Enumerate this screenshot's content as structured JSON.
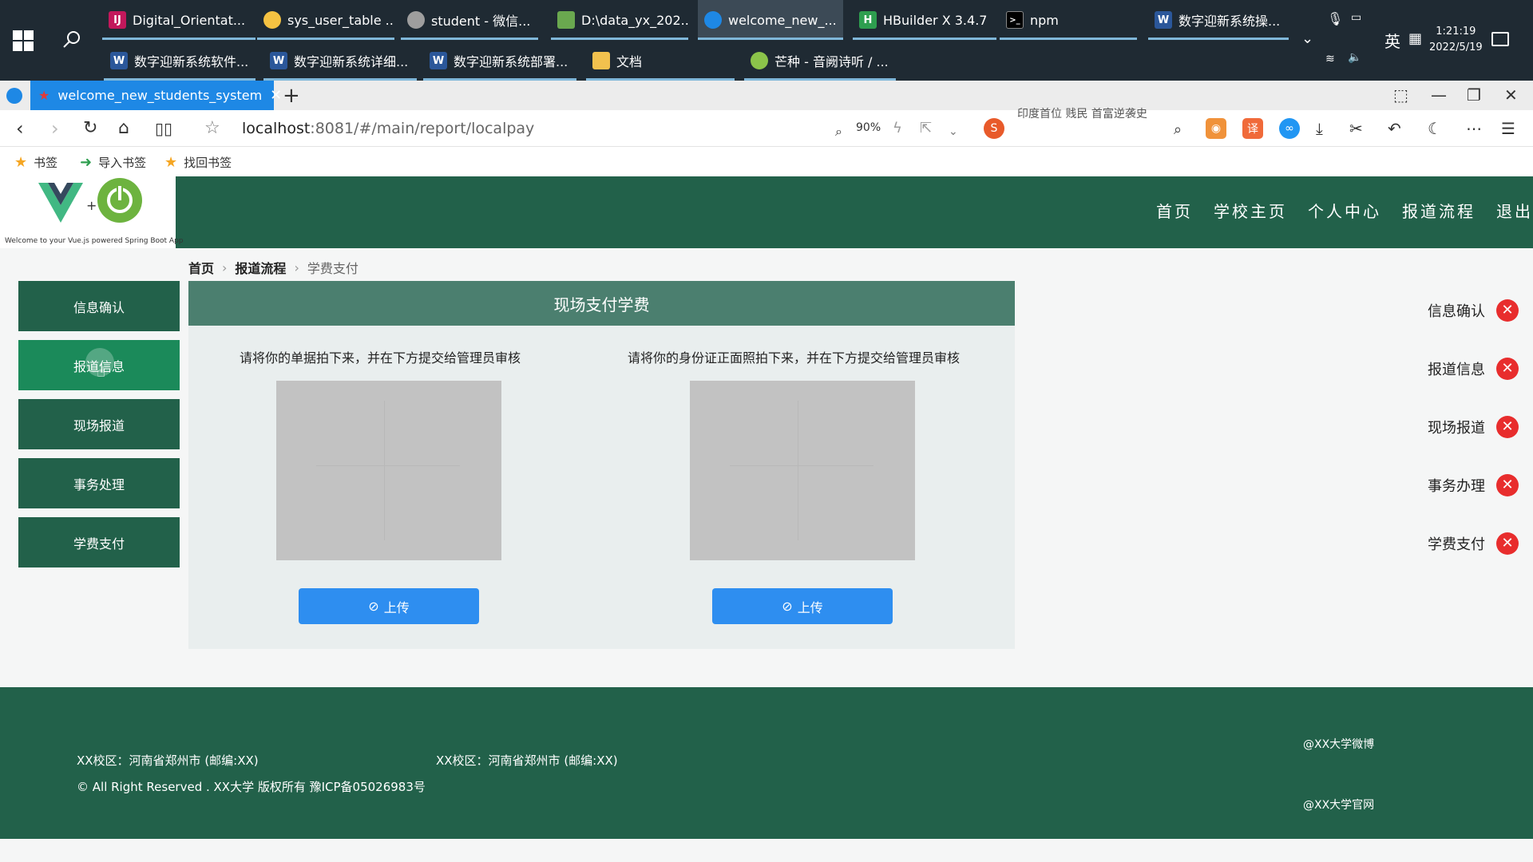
{
  "taskbar": {
    "row1": [
      {
        "label": "Digital_Orientat...",
        "icon": "intellij-icon",
        "color": "#c2185b"
      },
      {
        "label": "sys_user_table ...",
        "icon": "navicat-icon",
        "color": "#f5c242"
      },
      {
        "label": "student - 微信...",
        "icon": "wechat-icon",
        "color": "#9e9e9e"
      },
      {
        "label": "D:\\data_yx_202...",
        "icon": "image-viewer-icon",
        "color": "#6aa84f"
      },
      {
        "label": "welcome_new_...",
        "icon": "browser-icon",
        "color": "#1e88e5"
      },
      {
        "label": "HBuilder X 3.4.7",
        "icon": "hbuilder-icon",
        "color": "#2e9e4f"
      },
      {
        "label": "npm",
        "icon": "terminal-icon",
        "color": "#000000"
      },
      {
        "label": "数字迎新系统操...",
        "icon": "word-icon",
        "color": "#2b579a"
      }
    ],
    "row2": [
      {
        "label": "数字迎新系统软件...",
        "icon": "word-icon",
        "color": "#2b579a"
      },
      {
        "label": "数字迎新系统详细...",
        "icon": "word-icon",
        "color": "#2b579a"
      },
      {
        "label": "数字迎新系统部署...",
        "icon": "word-icon",
        "color": "#2b579a"
      },
      {
        "label": "文档",
        "icon": "folder-icon",
        "color": "#f2c14e"
      },
      {
        "label": "芒种 - 音阙诗听 / ...",
        "icon": "music-player-icon",
        "color": "#8bc34a"
      }
    ],
    "ime": "英",
    "time": "1:21:19",
    "date": "2022/5/19"
  },
  "browser": {
    "tab_title": "welcome_new_students_system",
    "url_host": "localhost",
    "url_rest": ":8081/#/main/report/localpay",
    "zoom": "90%",
    "hint_text": "印度首位 贱民 首富逆袭史",
    "bookmarks": [
      "书签",
      "导入书签",
      "找回书签"
    ]
  },
  "site": {
    "logo_caption": "Welcome to your Vue.js powered Spring Boot App",
    "nav": [
      "首页",
      "学校主页",
      "个人中心",
      "报道流程",
      "退出"
    ],
    "breadcrumb": [
      "首页",
      "报道流程",
      "学费支付"
    ],
    "side_menu": [
      "信息确认",
      "报道信息",
      "现场报道",
      "事务处理",
      "学费支付"
    ],
    "card_title": "现场支付学费",
    "upload_left_hint": "请将你的单据拍下来，并在下方提交给管理员审核",
    "upload_right_hint": "请将你的身份证正面照拍下来，并在下方提交给管理员审核",
    "upload_button": "上传",
    "steps": [
      "信息确认",
      "报道信息",
      "现场报道",
      "事务办理",
      "学费支付"
    ],
    "footer": {
      "campus1": "XX校区：河南省郑州市 (邮编:XX)",
      "campus2": "XX校区：河南省郑州市 (邮编:XX)",
      "copyright": "© All Right Reserved . XX大学 版权所有 豫ICP备05026983号",
      "weibo": "@XX大学微博",
      "official": "@XX大学官网"
    }
  },
  "colors": {
    "brand_green": "#22614a",
    "active_green": "#1b8a5a",
    "card_header": "#4b7f6f",
    "upload_blue": "#2e8ef0",
    "status_red": "#e82d2d"
  }
}
